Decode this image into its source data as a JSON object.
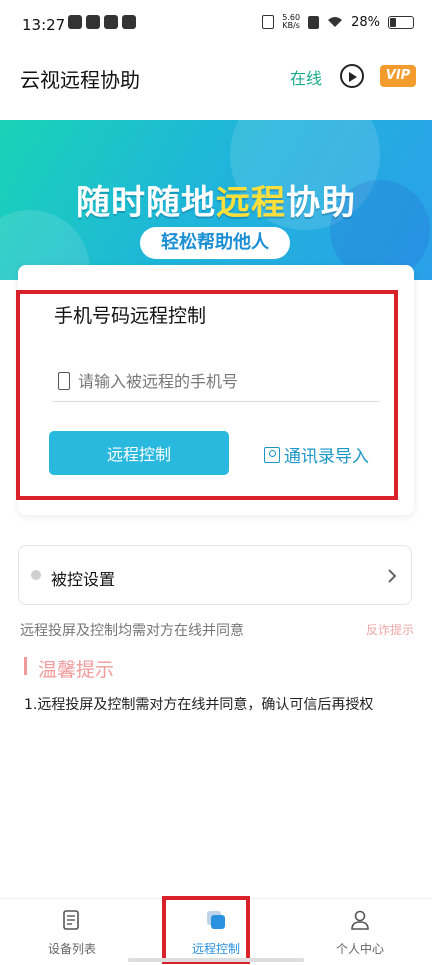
{
  "status_bar": {
    "time": "13:27",
    "speed_value": "5.60",
    "speed_unit": "KB/s",
    "battery": "28%"
  },
  "header": {
    "title": "云视远程协助",
    "online_status": "在线",
    "vip_label": "VIP",
    "play_icon": "play-circle-icon"
  },
  "banner": {
    "title_part1": "随时随地",
    "title_highlight": "远程",
    "title_part2": "协助",
    "subtitle": "轻松帮助他人"
  },
  "remote_card": {
    "title": "手机号码远程控制",
    "phone_placeholder": "请输入被远程的手机号",
    "phone_value": "",
    "control_button": "远程控制",
    "contacts_import": "通讯录导入"
  },
  "settings": {
    "controlled_settings_label": "被控设置"
  },
  "notice": {
    "text": "远程投屏及控制均需对方在线并同意",
    "feedback_link": "反诈提示"
  },
  "tips": {
    "title": "温馨提示",
    "item1": "1.远程投屏及控制需对方在线并同意，确认可信后再授权"
  },
  "tabbar": {
    "tabs": [
      {
        "label": "设备列表",
        "icon": "device-list-icon"
      },
      {
        "label": "远程控制",
        "icon": "remote-control-icon"
      },
      {
        "label": "个人中心",
        "icon": "profile-icon"
      }
    ],
    "active": "远程控制"
  },
  "colors": {
    "accent": "#29b8de",
    "online": "#1aab8b",
    "vip": "#f39b2d",
    "highlight_border": "#d9212c",
    "tip": "#f19a9a"
  }
}
